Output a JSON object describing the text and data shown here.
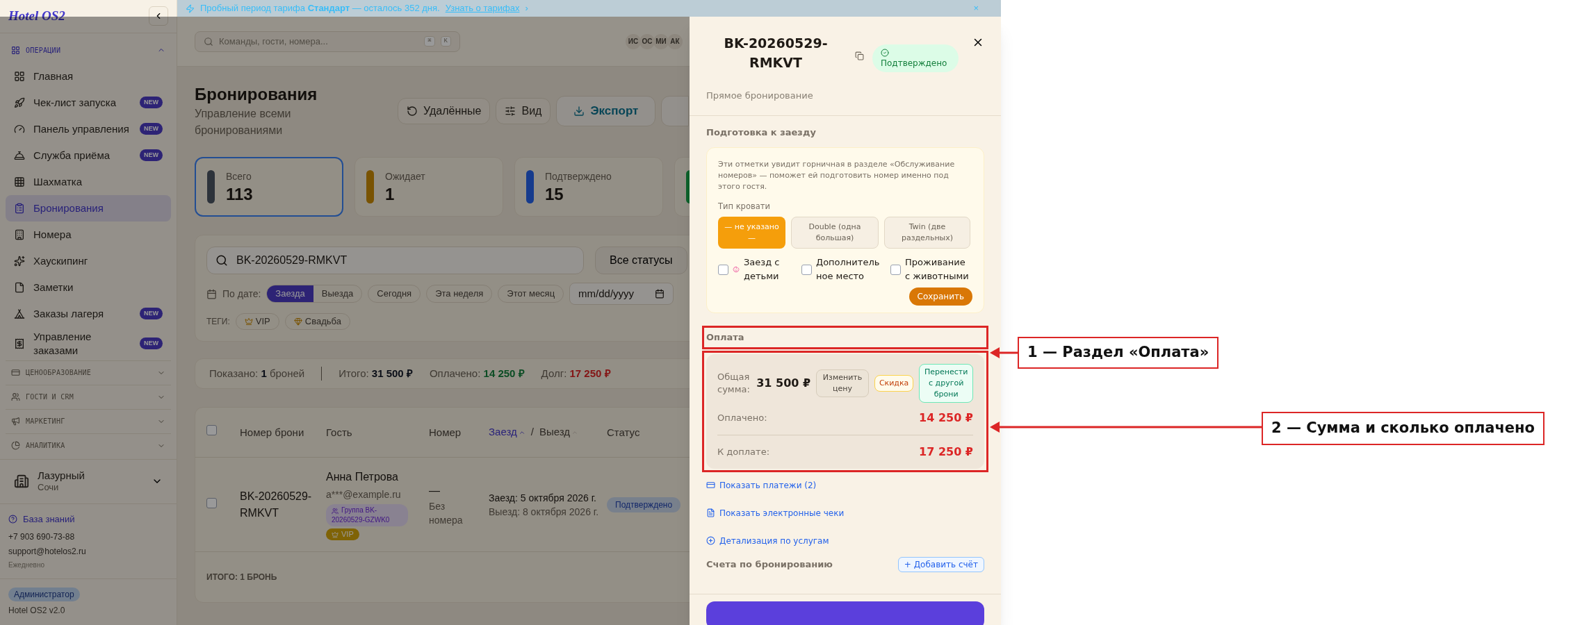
{
  "banner": {
    "text": "Пробный период тарифа **Стандарт** — осталось 352 дня.",
    "link": "Узнать о тарифах",
    "chevron": "›",
    "close": "×"
  },
  "sidebar": {
    "logo": "Hotel OS2",
    "sections": [
      {
        "title": "ОПЕРАЦИИ",
        "expanded": true,
        "items": [
          {
            "label": "Главная",
            "selected": false
          },
          {
            "label": "Чек-лист запуска",
            "badge": "NEW",
            "selected": false
          },
          {
            "label": "Панель управления",
            "badge": "NEW",
            "selected": false
          },
          {
            "label": "Служба приёма",
            "badge": "NEW",
            "selected": false
          },
          {
            "label": "Шахматка",
            "selected": false
          },
          {
            "label": "Бронирования",
            "selected": true
          },
          {
            "label": "Номера",
            "selected": false
          },
          {
            "label": "Хаускипинг",
            "selected": false
          },
          {
            "label": "Заметки",
            "selected": false
          },
          {
            "label": "Заказы лагеря",
            "badge": "NEW",
            "selected": false
          },
          {
            "label": "Управление заказами",
            "badge": "NEW",
            "selected": false
          }
        ]
      },
      {
        "title": "ЦЕНООБРАЗОВАНИЕ",
        "expanded": false
      },
      {
        "title": "ГОСТИ И CRM",
        "expanded": false
      },
      {
        "title": "МАРКЕТИНГ",
        "expanded": false
      },
      {
        "title": "АНАЛИТИКА",
        "expanded": false
      }
    ],
    "property": {
      "name": "Лазурный",
      "city": "Сочи"
    },
    "help": {
      "link": "База знаний",
      "phone": "+7 903 690-73-88",
      "email": "support@hotelos2.ru",
      "hours": "Ежедневно"
    },
    "role": "Администратор",
    "version": "Hotel OS2 v2.0"
  },
  "header": {
    "search_placeholder": "Команды, гости, номера...",
    "keys": [
      "⌘",
      "K"
    ],
    "avatars": [
      "ИС",
      "ОС",
      "МИ",
      "АК"
    ]
  },
  "page": {
    "title": "Бронирования",
    "subtitle": "Управление всеми бронированиями",
    "actions": [
      {
        "label": "Удалённые"
      },
      {
        "label": "Вид"
      },
      {
        "label": "Экспорт",
        "kind": "primary"
      }
    ]
  },
  "stats": [
    {
      "label": "Всего",
      "value": "113",
      "kind": "total",
      "selected": true
    },
    {
      "label": "Ожидает",
      "value": "1",
      "kind": "pending",
      "selected": false
    },
    {
      "label": "Подтверждено",
      "value": "15",
      "kind": "confirmed",
      "selected": false
    },
    {
      "kind": "active",
      "selected": false
    }
  ],
  "filters": {
    "search": "BK-20260529-RMKVT",
    "status": "Все статусы",
    "date_label": "По дате:",
    "date_modes": [
      {
        "label": "Заезда",
        "selected": true
      },
      {
        "label": "Выезда",
        "selected": false
      }
    ],
    "presets": [
      "Сегодня",
      "Эта неделя",
      "Этот месяц"
    ],
    "date_placeholder": "mm/dd/yyyy",
    "tags_label": "ТЕГИ:",
    "tags": [
      "VIP",
      "Свадьба"
    ]
  },
  "summary": [
    {
      "label": "Показано:",
      "value": "1",
      "suffix": "броней",
      "kind": "count"
    },
    {
      "label": "Итого:",
      "value": "31 500 ₽",
      "kind": "total"
    },
    {
      "label": "Оплачено:",
      "value": "14 250 ₽",
      "kind": "paid"
    },
    {
      "label": "Долг:",
      "value": "17 250 ₽",
      "kind": "debt"
    }
  ],
  "table": {
    "select_all": {
      "checked": false
    },
    "columns": [
      {
        "kind": "text",
        "label": "Номер брони"
      },
      {
        "kind": "text",
        "label": "Гость"
      },
      {
        "kind": "text",
        "label": "Номер"
      },
      {
        "kind": "sort",
        "separator": "/",
        "parts": [
          {
            "label": "Заезд",
            "selected": true
          },
          {
            "label": "Выезд",
            "selected": false
          }
        ]
      },
      {
        "kind": "text",
        "label": "Статус"
      }
    ],
    "rows": [
      {
        "checked": false,
        "number": "BK-20260529-RMKVT",
        "guest": "Анна Петрова",
        "email": "a***@example.ru",
        "group": "Группа BK-20260529-GZWK0",
        "tag": "VIP",
        "room": "—",
        "room_note": "Без номера",
        "checkin": "Заезд: 5 октября 2026 г.",
        "checkout": "Выезд: 8 октября 2026 г.",
        "status": "Подтверждено"
      }
    ],
    "footer": "ИТОГО: 1 БРОНЬ"
  },
  "drawer": {
    "title": "BK-20260529-RMKVT",
    "status": "Подтверждено",
    "source": "Прямое бронирование",
    "prep": {
      "title": "Подготовка к заезду",
      "note": "Эти отметки увидит горничная в разделе «Обслуживание номеров» — поможет ей подготовить номер именно под этого гостя.",
      "bed_label": "Тип кровати",
      "beds": [
        {
          "label": "— не указано —",
          "selected": true
        },
        {
          "label": "Double (одна большая)",
          "selected": false
        },
        {
          "label": "Twin (две раздельных)",
          "selected": false
        }
      ],
      "options": [
        {
          "label": "Заезд с детьми",
          "checked": false
        },
        {
          "label": "Дополнительное место",
          "checked": false
        },
        {
          "label": "Проживание с животными",
          "checked": false
        }
      ],
      "save": "Сохранить"
    },
    "payment": {
      "title": "Оплата",
      "total_label": "Общая сумма:",
      "total": "31 500 ₽",
      "buttons": [
        {
          "label": "Изменить цену",
          "kind": "neutral"
        },
        {
          "label": "Скидка",
          "kind": "warning"
        },
        {
          "label": "Перенести с другой брони",
          "kind": "success"
        }
      ],
      "paid_label": "Оплачено:",
      "paid": "14 250 ₽",
      "due_label": "К доплате:",
      "due": "17 250 ₽"
    },
    "links": [
      "Показать платежи (2)",
      "Показать электронные чеки",
      "Детализация по услугам"
    ],
    "invoices": {
      "title": "Счета по бронированию",
      "add": "+ Добавить счёт"
    }
  },
  "annotations": [
    {
      "text": "1 — Раздел «Оплата»"
    },
    {
      "text": "2 — Сумма и сколько оплачено"
    }
  ]
}
